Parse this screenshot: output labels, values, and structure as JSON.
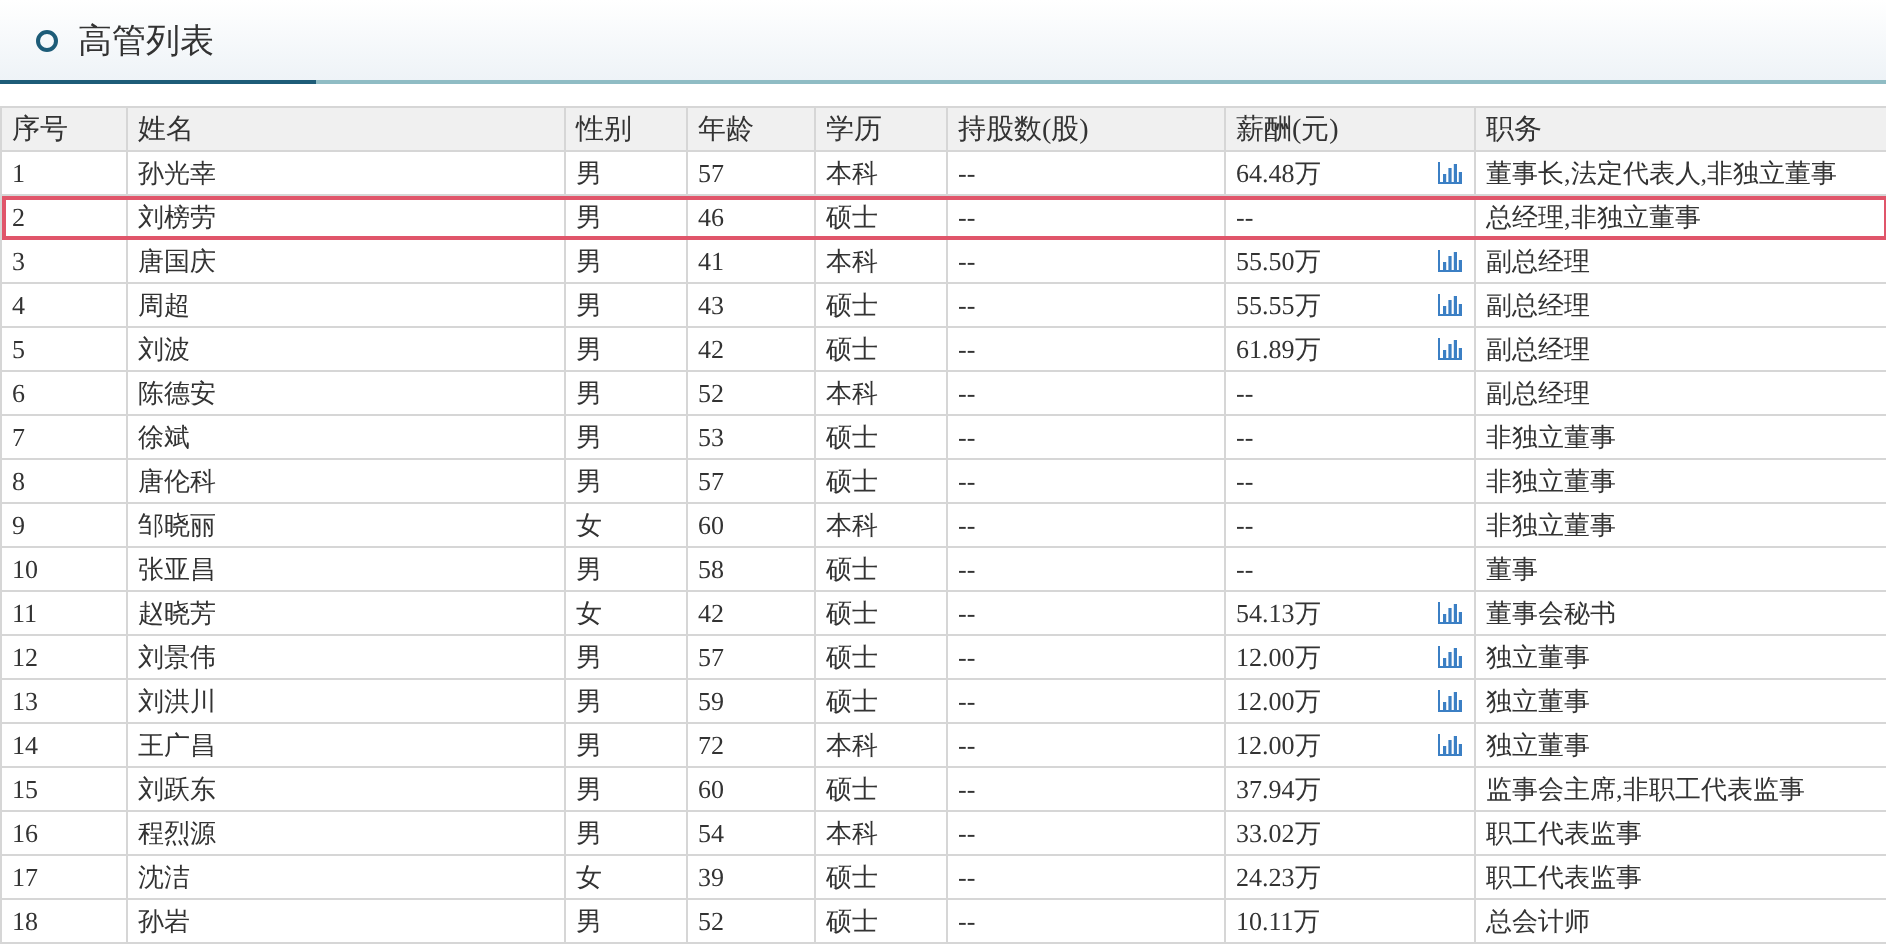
{
  "title": "高管列表",
  "table": {
    "columns": [
      "序号",
      "姓名",
      "性别",
      "年龄",
      "学历",
      "持股数(股)",
      "薪酬(元)",
      "职务"
    ],
    "rows": [
      {
        "cells": [
          "1",
          "孙光幸",
          "男",
          "57",
          "本科",
          "--",
          "64.48万",
          "董事长,法定代表人,非独立董事"
        ],
        "has_chart": true,
        "selected": false
      },
      {
        "cells": [
          "2",
          "刘榜劳",
          "男",
          "46",
          "硕士",
          "--",
          "--",
          "总经理,非独立董事"
        ],
        "has_chart": false,
        "selected": true
      },
      {
        "cells": [
          "3",
          "唐国庆",
          "男",
          "41",
          "本科",
          "--",
          "55.50万",
          "副总经理"
        ],
        "has_chart": true,
        "selected": false
      },
      {
        "cells": [
          "4",
          "周超",
          "男",
          "43",
          "硕士",
          "--",
          "55.55万",
          "副总经理"
        ],
        "has_chart": true,
        "selected": false
      },
      {
        "cells": [
          "5",
          "刘波",
          "男",
          "42",
          "硕士",
          "--",
          "61.89万",
          "副总经理"
        ],
        "has_chart": true,
        "selected": false
      },
      {
        "cells": [
          "6",
          "陈德安",
          "男",
          "52",
          "本科",
          "--",
          "--",
          "副总经理"
        ],
        "has_chart": false,
        "selected": false
      },
      {
        "cells": [
          "7",
          "徐斌",
          "男",
          "53",
          "硕士",
          "--",
          "--",
          "非独立董事"
        ],
        "has_chart": false,
        "selected": false
      },
      {
        "cells": [
          "8",
          "唐伦科",
          "男",
          "57",
          "硕士",
          "--",
          "--",
          "非独立董事"
        ],
        "has_chart": false,
        "selected": false
      },
      {
        "cells": [
          "9",
          "邹晓丽",
          "女",
          "60",
          "本科",
          "--",
          "--",
          "非独立董事"
        ],
        "has_chart": false,
        "selected": false
      },
      {
        "cells": [
          "10",
          "张亚昌",
          "男",
          "58",
          "硕士",
          "--",
          "--",
          "董事"
        ],
        "has_chart": false,
        "selected": false
      },
      {
        "cells": [
          "11",
          "赵晓芳",
          "女",
          "42",
          "硕士",
          "--",
          "54.13万",
          "董事会秘书"
        ],
        "has_chart": true,
        "selected": false
      },
      {
        "cells": [
          "12",
          "刘景伟",
          "男",
          "57",
          "硕士",
          "--",
          "12.00万",
          "独立董事"
        ],
        "has_chart": true,
        "selected": false
      },
      {
        "cells": [
          "13",
          "刘洪川",
          "男",
          "59",
          "硕士",
          "--",
          "12.00万",
          "独立董事"
        ],
        "has_chart": true,
        "selected": false
      },
      {
        "cells": [
          "14",
          "王广昌",
          "男",
          "72",
          "本科",
          "--",
          "12.00万",
          "独立董事"
        ],
        "has_chart": true,
        "selected": false
      },
      {
        "cells": [
          "15",
          "刘跃东",
          "男",
          "60",
          "硕士",
          "--",
          "37.94万",
          "监事会主席,非职工代表监事"
        ],
        "has_chart": false,
        "selected": false
      },
      {
        "cells": [
          "16",
          "程烈源",
          "男",
          "54",
          "本科",
          "--",
          "33.02万",
          "职工代表监事"
        ],
        "has_chart": false,
        "selected": false
      },
      {
        "cells": [
          "17",
          "沈洁",
          "女",
          "39",
          "硕士",
          "--",
          "24.23万",
          "职工代表监事"
        ],
        "has_chart": false,
        "selected": false
      },
      {
        "cells": [
          "18",
          "孙岩",
          "男",
          "52",
          "硕士",
          "--",
          "10.11万",
          "总会计师"
        ],
        "has_chart": false,
        "selected": false
      }
    ]
  }
}
